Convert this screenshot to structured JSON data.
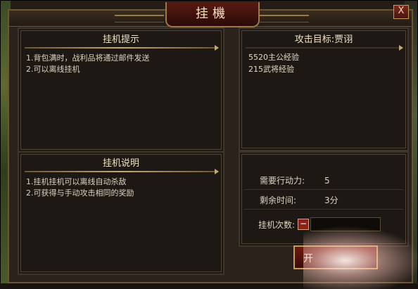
{
  "window": {
    "title": "挂機",
    "close_glyph": "X"
  },
  "tips": {
    "heading": "挂机提示",
    "lines": [
      "1.背包满时，战利品将通过邮件发送",
      "2.可以离线挂机"
    ]
  },
  "instructions": {
    "heading": "挂机说明",
    "lines": [
      "1.挂机挂机可以离线自动杀敌",
      "2.可获得与手动攻击相同的奖励"
    ]
  },
  "target": {
    "heading": "攻击目标:贾诩",
    "rewards": [
      "5520主公经验",
      "215武将经验"
    ]
  },
  "cost": {
    "action_label": "需要行动力:",
    "action_value": "5",
    "time_label": "剩余时间:",
    "time_value": "3分",
    "count_label": "挂机次数:",
    "minus_glyph": "−",
    "count_value": ""
  },
  "start_button": {
    "label": "开"
  }
}
